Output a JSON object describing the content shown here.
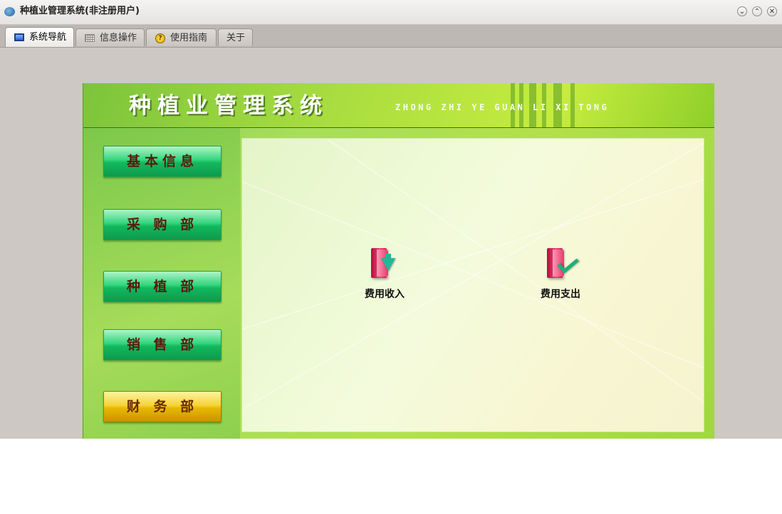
{
  "window": {
    "title": "种植业管理系统(非注册用户)"
  },
  "tabs": [
    {
      "label": "系统导航",
      "icon": "monitor-icon",
      "active": true
    },
    {
      "label": "信息操作",
      "icon": "grid-icon",
      "active": false
    },
    {
      "label": "使用指南",
      "icon": "help-icon",
      "active": false
    },
    {
      "label": "关于",
      "icon": "",
      "active": false
    }
  ],
  "header": {
    "title": "种植业管理系统",
    "pinyin": "ZHONG ZHI YE GUAN LI XI TONG"
  },
  "sidebar": {
    "items": [
      {
        "label": "基本信息",
        "selected": false
      },
      {
        "label": "采 购 部",
        "selected": false
      },
      {
        "label": "种 植 部",
        "selected": false
      },
      {
        "label": "销 售 部",
        "selected": false
      },
      {
        "label": "财 务 部",
        "selected": true
      }
    ]
  },
  "modules": [
    {
      "label": "费用收入",
      "icon": "income-book-icon"
    },
    {
      "label": "费用支出",
      "icon": "expense-book-icon"
    }
  ],
  "colors": {
    "selected_button": "#e8b800",
    "nav_button": "#12b85e",
    "panel_green": "#a7de5a"
  }
}
